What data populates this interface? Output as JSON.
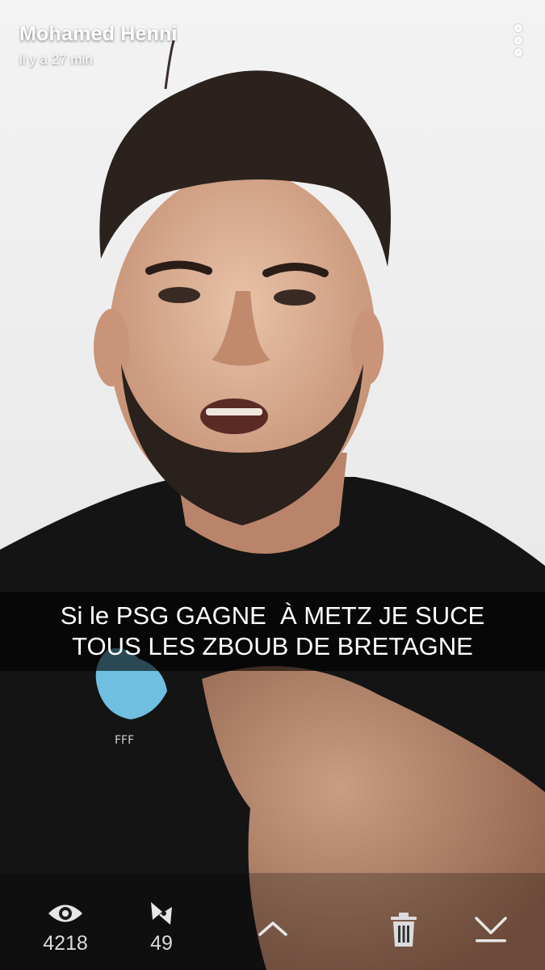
{
  "story": {
    "username": "Mohamed Henni",
    "timestamp": "il y a 27 min"
  },
  "caption": {
    "line1": "Si le PSG GAGNE  À METZ JE SUCE",
    "line2": "TOUS LES ZBOUB DE BRETAGNE"
  },
  "stats": {
    "views": "4218",
    "screenshots": "49"
  },
  "icons": {
    "more": "more-vertical-icon",
    "views": "eye-icon",
    "screenshots": "screenshot-arrows-icon",
    "up": "chevron-up-icon",
    "delete": "trash-icon",
    "save": "download-icon"
  },
  "colors": {
    "overlay_text": "#ffffff",
    "caption_bg": "rgba(0,0,0,0.62)"
  }
}
